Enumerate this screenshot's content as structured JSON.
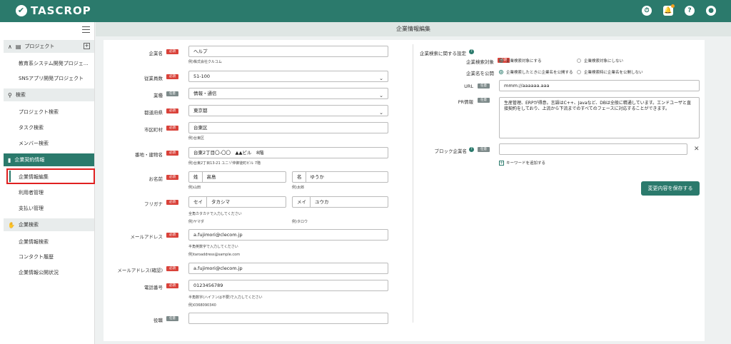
{
  "brand": {
    "name": "TASCROP"
  },
  "sidebar": {
    "project_section": "プロジェクト",
    "projects": [
      "教育系システム開発プロジェ…",
      "SNSアプリ開発プロジェクト"
    ],
    "search_section": "検索",
    "search_items": [
      "プロジェクト検索",
      "タスク検索",
      "メンバー検索"
    ],
    "contract_section": "企業契約情報",
    "contract_items": [
      "企業情報編集",
      "利用者管理",
      "支払い管理"
    ],
    "company_search_section": "企業検索",
    "company_items": [
      "企業情報検索",
      "コンタクト履歴",
      "企業情報公開状況"
    ]
  },
  "header": {
    "title": "企業情報編集"
  },
  "badges": {
    "required": "必須",
    "optional": "任意"
  },
  "form": {
    "company_name": {
      "label": "企業名",
      "value": "ヘルプ",
      "hint": "例)株式会社クルコム"
    },
    "employees": {
      "label": "従業員数",
      "value": "51-100"
    },
    "industry": {
      "label": "業種",
      "value": "情報・通信"
    },
    "prefecture": {
      "label": "都道府県",
      "value": "東京都"
    },
    "city": {
      "label": "市区町村",
      "value": "台東区",
      "hint": "例)台東区"
    },
    "address": {
      "label": "番地・建物名",
      "value": "台東2丁目〇-〇〇　▲▲ビル　8階",
      "hint": "例)台東2丁目13-21 ユニゾ仲御徒町ビル 7階"
    },
    "name": {
      "label": "お名前",
      "last_prefix": "姓",
      "last_value": "高島",
      "last_hint": "例)山田",
      "first_prefix": "名",
      "first_value": "ゆうか",
      "first_hint": "例)太郎"
    },
    "furigana": {
      "label": "フリガナ",
      "last_prefix": "セイ",
      "last_value": "タカシマ",
      "first_prefix": "メイ",
      "first_value": "ユウカ",
      "hint": "全角カタカナで入力してください",
      "last_hint": "例)ヤマダ",
      "first_hint": "例)タロウ"
    },
    "email": {
      "label": "メールアドレス",
      "value": "a.fujimori@clecom.jp",
      "hint": "半角英数字で入力してください",
      "example": "例)taroaddress@sample.com"
    },
    "email_confirm": {
      "label": "メールアドレス(確認)",
      "value": "a.fujimori@clecom.jp"
    },
    "phone": {
      "label": "電話番号",
      "value": "0123456789",
      "hint": "半角数字(ハイフンは不要)で入力してください",
      "example": "例)0368090340"
    },
    "position": {
      "label": "役職",
      "value": ""
    }
  },
  "right": {
    "section_title": "企業検索に関する設定",
    "search_target": {
      "label": "企業検索対象",
      "option_on": "企業検索対象にする",
      "option_off": "企業検索対象にしない"
    },
    "publish_name": {
      "label": "企業名を公開",
      "option_on": "企業検索したときに企業名を公開する",
      "option_off": "企業検索時に企業名を公開しない"
    },
    "url": {
      "label": "URL",
      "value": "mmm://aaaaaa.aaa"
    },
    "pr": {
      "label": "PR情報",
      "value": "生産管理、ERPが得意。言語はC++、Javaなど、DBは全般に精通しています。エンドユーザと直接契約をしており、上流から下流までのすべてのフェースに対応することができます。"
    },
    "block": {
      "label": "ブロック企業名",
      "value": "",
      "add_keyword": "キーワードを追加する"
    },
    "save_button": "変更内容を保存する"
  }
}
